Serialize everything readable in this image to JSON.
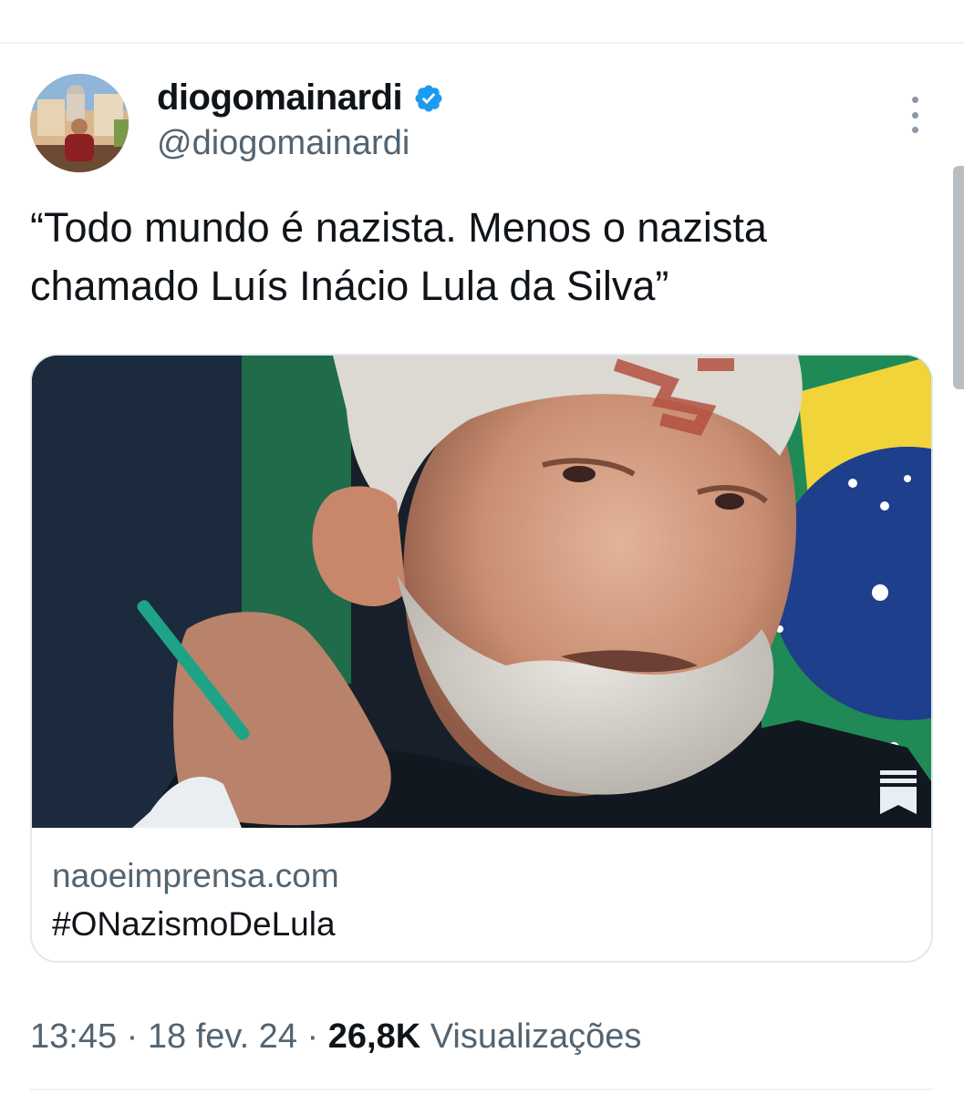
{
  "tweet": {
    "author": {
      "display_name": "diogomainardi",
      "handle": "@diogomainardi",
      "verified": true
    },
    "text": "“Todo mundo é nazista. Menos o nazista\nchamado Luís Inácio Lula da Silva”",
    "card": {
      "domain": "naoeimprensa.com",
      "title": "#ONazismoDeLula"
    },
    "meta": {
      "time": "13:45",
      "separator": " · ",
      "date": "18 fev. 24",
      "views_count": "26,8K",
      "views_label": "Visualizações"
    }
  },
  "colors": {
    "verified": "#1d9bf0",
    "secondary_text": "#536471",
    "primary_text": "#0f1419"
  },
  "icons": {
    "verified": "verified-badge-icon",
    "more": "more-vertical-icon",
    "bookmark": "bookmark-icon"
  }
}
